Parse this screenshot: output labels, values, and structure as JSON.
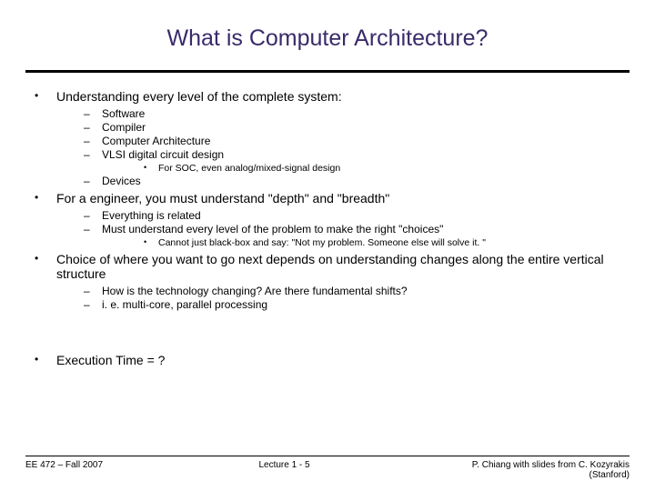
{
  "title": "What is Computer Architecture?",
  "bullets": {
    "b0": {
      "text": "Understanding every level of the complete system:",
      "sub": {
        "s0": "Software",
        "s1": "Compiler",
        "s2": "Computer Architecture",
        "s3": "VLSI digital circuit design",
        "s3_sub0": "For SOC, even analog/mixed-signal design",
        "s4": "Devices"
      }
    },
    "b1": {
      "text": "For a engineer, you must understand \"depth\" and \"breadth\"",
      "sub": {
        "s0": "Everything is related",
        "s1": "Must understand every level of the problem to make the right \"choices\"",
        "s1_sub0": "Cannot just black-box and say: \"Not my problem.  Someone else will solve it. \""
      }
    },
    "b2": {
      "text": "Choice of where you want to go next depends on understanding changes along the entire vertical structure",
      "sub": {
        "s0": "How is the technology changing?  Are there fundamental shifts?",
        "s1": "i. e. multi-core, parallel processing"
      }
    },
    "b3": {
      "text": "Execution Time = ?"
    }
  },
  "footer": {
    "left": "EE 472 – Fall 2007",
    "center": "Lecture 1 - 5",
    "right": "P. Chiang with slides from C. Kozyrakis (Stanford)"
  }
}
